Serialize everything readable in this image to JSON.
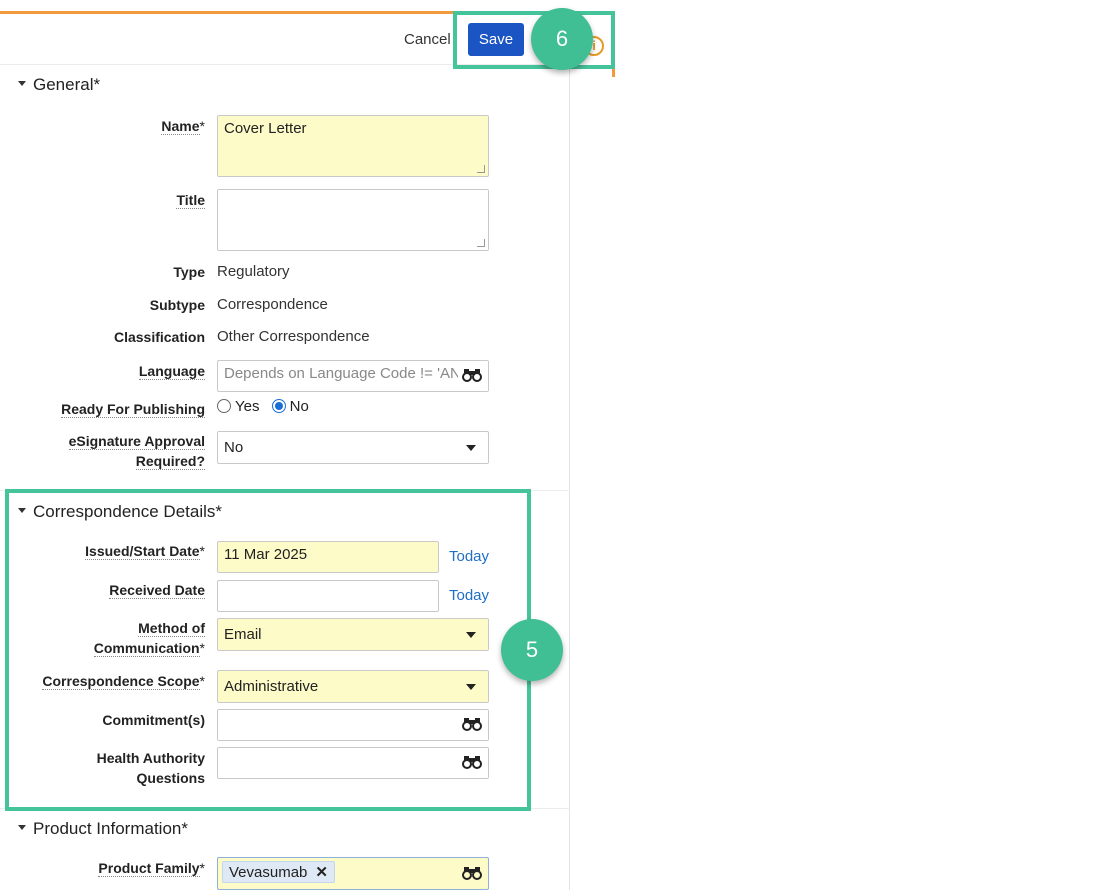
{
  "toolbar": {
    "cancel_label": "Cancel",
    "save_label": "Save",
    "info_glyph": "i"
  },
  "sections": {
    "general": "General*",
    "correspondence": "Correspondence Details*",
    "product": "Product Information*"
  },
  "general": {
    "name_label": "Name",
    "name_value": "Cover Letter",
    "title_label": "Title",
    "title_value": "",
    "type_label": "Type",
    "type_value": "Regulatory",
    "subtype_label": "Subtype",
    "subtype_value": "Correspondence",
    "classification_label": "Classification",
    "classification_value": "Other Correspondence",
    "language_label": "Language",
    "language_placeholder": "Depends on Language Code != 'AN",
    "publishing_label": "Ready For Publishing",
    "publishing_yes": "Yes",
    "publishing_no": "No",
    "publishing_selected": "No",
    "esig_label_line1": "eSignature Approval",
    "esig_label_line2": "Required?",
    "esig_value": "No"
  },
  "correspondence": {
    "issued_label": "Issued/Start Date",
    "issued_value": "11 Mar 2025",
    "received_label": "Received Date",
    "received_value": "",
    "today_label": "Today",
    "method_label_line1": "Method of",
    "method_label_line2": "Communication",
    "method_value": "Email",
    "scope_label": "Correspondence Scope",
    "scope_value": "Administrative",
    "commitments_label": "Commitment(s)",
    "haq_label_line1": "Health Authority",
    "haq_label_line2": "Questions"
  },
  "product": {
    "family_label": "Product Family",
    "family_token": "Vevasumab"
  },
  "required_marker": "*",
  "annotations": {
    "step_save": "6",
    "step_details": "5"
  },
  "colors": {
    "accent_orange": "#f29a3e",
    "save_blue": "#1b55c4",
    "required_yellow": "#fdfbc8",
    "highlight_green": "#45c39a",
    "link_blue": "#1f6fc6"
  },
  "icons": {
    "lookup": "binoculars-icon",
    "dropdown": "caret-down-icon",
    "section_toggle": "caret-down-icon",
    "info": "info-icon"
  }
}
